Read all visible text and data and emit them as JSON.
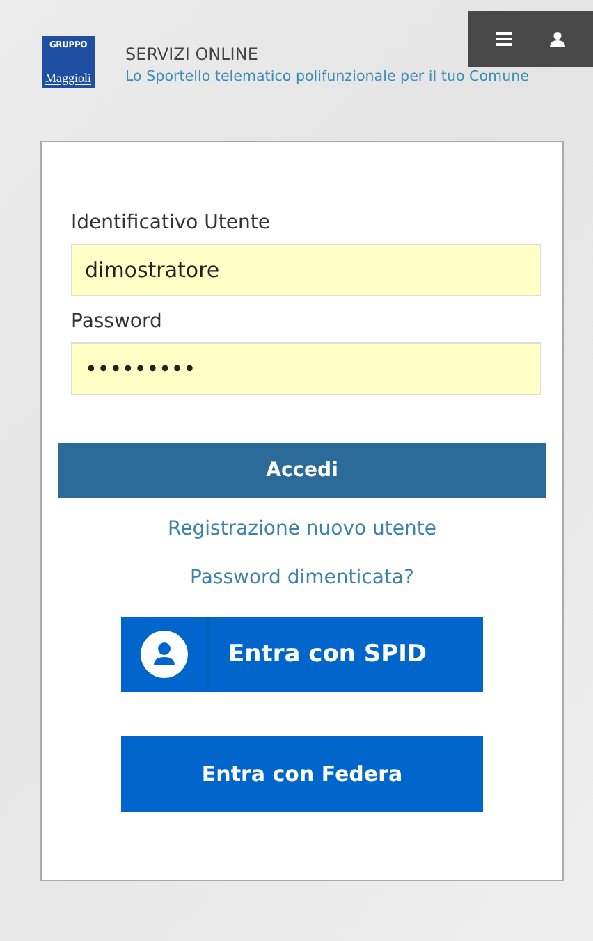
{
  "header": {
    "logo": {
      "top": "GRUPPO",
      "bottom": "Maggioli"
    },
    "title": "SERVIZI ONLINE",
    "subtitle": "Lo Sportello telematico polifunzionale per il tuo Comune"
  },
  "login": {
    "fields": [
      {
        "label": "Identificativo Utente",
        "value": "dimostratore"
      },
      {
        "label": "Password",
        "value": "•••••••••"
      }
    ],
    "submit": "Accedi",
    "links": [
      "Registrazione nuovo utente",
      "Password dimenticata?"
    ],
    "providers": [
      {
        "kind": "spid",
        "label": "Entra con SPID"
      },
      {
        "kind": "plain",
        "label": "Entra con Federa"
      }
    ]
  }
}
